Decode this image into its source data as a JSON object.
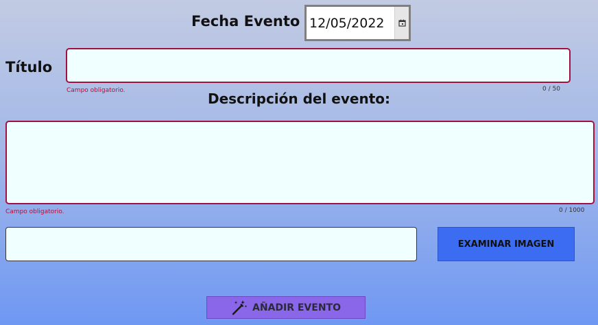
{
  "event_date": {
    "label": "Fecha Evento",
    "value": "12/05/2022",
    "picker_icon": "calendar-icon"
  },
  "title_field": {
    "label": "Título",
    "value": "",
    "error": "Campo obligatorio.",
    "counter": "0 / 50"
  },
  "description_field": {
    "label": "Descripción del evento:",
    "value": "",
    "error": "Campo obligatorio.",
    "counter": "0 / 1000"
  },
  "image_field": {
    "value": "",
    "browse_label": "EXAMINAR IMAGEN"
  },
  "submit": {
    "label": "AÑADIR EVENTO",
    "icon": "magic-wand-icon"
  },
  "colors": {
    "error": "#b0103a",
    "field_background": "#f0ffff",
    "browse_button": "#3c6cf2",
    "add_button": "#8a66e8"
  }
}
